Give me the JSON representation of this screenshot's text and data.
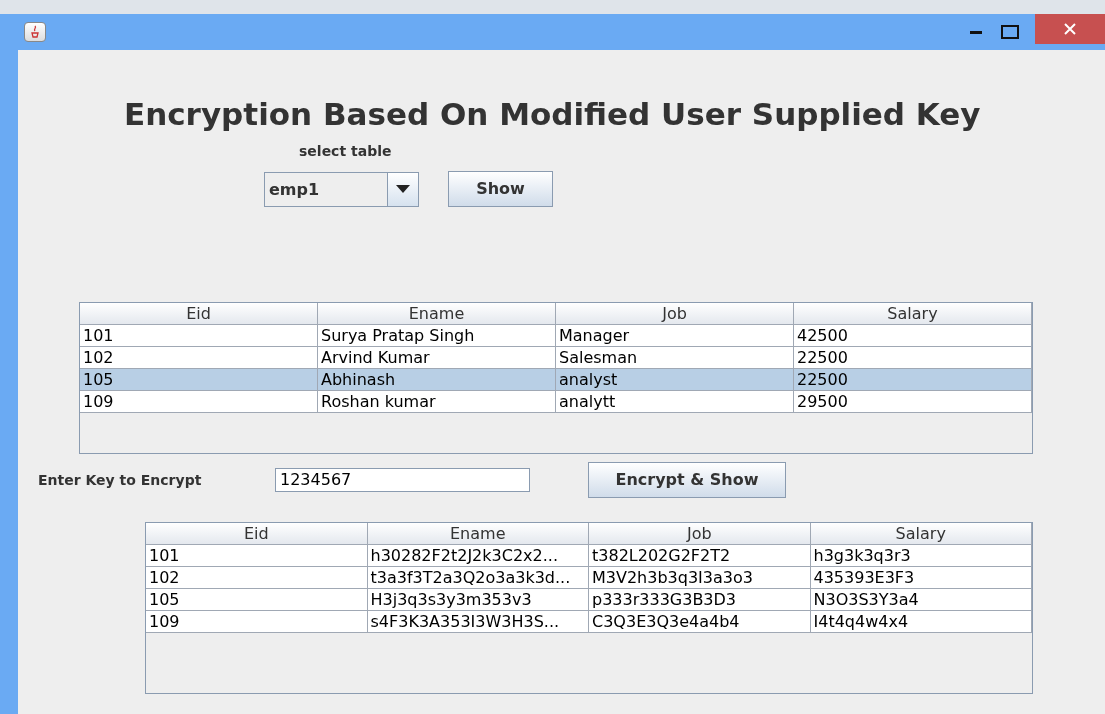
{
  "window": {
    "title": "Encryption Based On Modified User Supplied Key"
  },
  "select_label": "select table",
  "table_select": {
    "value": "emp1"
  },
  "show_button": "Show",
  "source_table": {
    "columns": [
      "Eid",
      "Ename",
      "Job",
      "Salary"
    ],
    "rows": [
      {
        "cells": [
          "101",
          "Surya Pratap Singh",
          "Manager",
          "42500"
        ],
        "selected": false
      },
      {
        "cells": [
          "102",
          "Arvind Kumar",
          "Salesman",
          "22500"
        ],
        "selected": false
      },
      {
        "cells": [
          "105",
          "Abhinash",
          "analyst",
          "22500"
        ],
        "selected": true
      },
      {
        "cells": [
          "109",
          "Roshan kumar",
          "analytt",
          "29500"
        ],
        "selected": false
      }
    ]
  },
  "key_label": "Enter Key to Encrypt",
  "key_field": {
    "value": "1234567"
  },
  "encrypt_button": "Encrypt & Show",
  "encrypted_table": {
    "columns": [
      "Eid",
      "Ename",
      "Job",
      "Salary"
    ],
    "rows": [
      {
        "cells": [
          "101",
          "h30282F2t2J2k3C2x2...",
          "t382L202G2F2T2",
          "h3g3k3q3r3"
        ],
        "selected": false
      },
      {
        "cells": [
          "102",
          "t3a3f3T2a3Q2o3a3k3d...",
          "M3V2h3b3q3I3a3o3",
          "435393E3F3"
        ],
        "selected": false
      },
      {
        "cells": [
          "105",
          "H3j3q3s3y3m353v3",
          "p333r333G3B3D3",
          "N3O3S3Y3a4"
        ],
        "selected": false
      },
      {
        "cells": [
          "109",
          "s4F3K3A353I3W3H3S...",
          "C3Q3E3Q3e4a4b4",
          "I4t4q4w4x4"
        ],
        "selected": false
      }
    ]
  }
}
